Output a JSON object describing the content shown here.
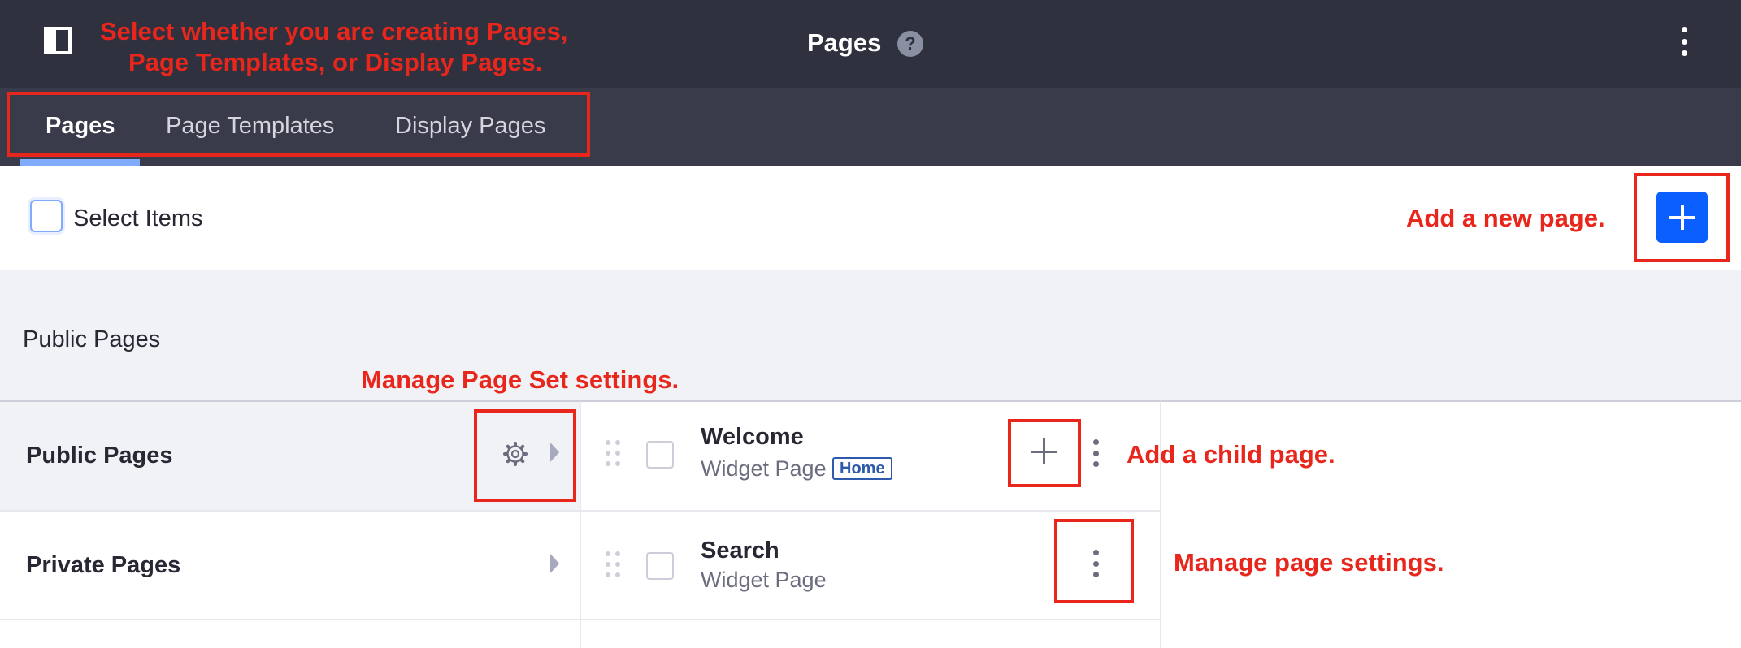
{
  "header": {
    "title": "Pages",
    "help_icon": "?"
  },
  "tabs": [
    {
      "label": "Pages",
      "active": true
    },
    {
      "label": "Page Templates",
      "active": false
    },
    {
      "label": "Display Pages",
      "active": false
    }
  ],
  "management_bar": {
    "select_label": "Select Items"
  },
  "section": {
    "heading": "Public Pages"
  },
  "page_sets": [
    {
      "label": "Public Pages",
      "active": true
    },
    {
      "label": "Private Pages",
      "active": false
    }
  ],
  "pages": [
    {
      "name": "Welcome",
      "type": "Widget Page",
      "badge": "Home"
    },
    {
      "name": "Search",
      "type": "Widget Page"
    }
  ],
  "annotations": {
    "tabs_line1": "Select whether you are creating Pages,",
    "tabs_line2": "Page Templates, or Display Pages.",
    "add_page": "Add a new page.",
    "page_set": "Manage Page Set settings.",
    "child_page": "Add a child page.",
    "page_settings": "Manage page settings."
  },
  "colors": {
    "annotation": "#e8261c",
    "primary": "#0b5fff",
    "topbar": "#30313f",
    "tabbar": "#393a4a"
  }
}
